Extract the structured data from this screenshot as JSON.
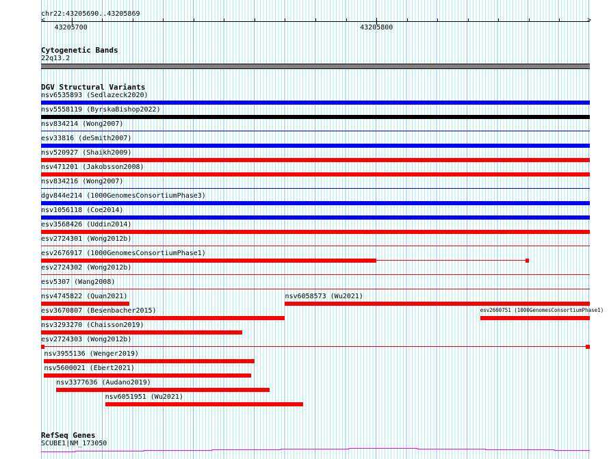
{
  "view": {
    "location": "chr22:43205690..43205869",
    "start": 43205690,
    "end": 43205870
  },
  "ruler": {
    "labels": [
      {
        "bp": 43205700,
        "text": "43205700"
      },
      {
        "bp": 43205800,
        "text": "43205800"
      }
    ]
  },
  "cytobands": {
    "title": "Cytogenetic Bands",
    "band": "22q13.2",
    "color": "#808080"
  },
  "dgv": {
    "title": "DGV Structural Variants",
    "colors": {
      "blue": "#0000ff",
      "red": "#ff0000",
      "black": "#000000"
    },
    "features": [
      {
        "label": "nsv6535893 (Sedlazeck2020)",
        "row": 0,
        "start": 43205690,
        "end": 43205870,
        "color": "blue",
        "style": "thick"
      },
      {
        "label": "nsv5558119 (ByrskaBishop2022)",
        "row": 1,
        "start": 43205690,
        "end": 43205870,
        "color": "black",
        "style": "thick"
      },
      {
        "label": "nsv834214 (Wong2007)",
        "row": 2,
        "start": 43205690,
        "end": 43205870,
        "color": "blue",
        "style": "thin"
      },
      {
        "label": "esv33816 (deSmith2007)",
        "row": 3,
        "start": 43205690,
        "end": 43205870,
        "color": "blue",
        "style": "thick"
      },
      {
        "label": "nsv520927 (Shaikh2009)",
        "row": 4,
        "start": 43205690,
        "end": 43205870,
        "color": "red",
        "style": "thick"
      },
      {
        "label": "nsv471201 (Jakobsson2008)",
        "row": 5,
        "start": 43205690,
        "end": 43205870,
        "color": "red",
        "style": "thick"
      },
      {
        "label": "nsv834216 (Wong2007)",
        "row": 6,
        "start": 43205690,
        "end": 43205870,
        "color": "blue",
        "style": "thin"
      },
      {
        "label": "dgv844e214 (1000GenomesConsortiumPhase3)",
        "row": 7,
        "start": 43205690,
        "end": 43205870,
        "color": "blue",
        "style": "thick"
      },
      {
        "label": "nsv1056118 (Coe2014)",
        "row": 8,
        "start": 43205690,
        "end": 43205870,
        "color": "blue",
        "style": "thick"
      },
      {
        "label": "esv3568426 (Uddin2014)",
        "row": 9,
        "start": 43205690,
        "end": 43205870,
        "color": "red",
        "style": "thick"
      },
      {
        "label": "esv2724301 (Wong2012b)",
        "row": 10,
        "start": 43205690,
        "end": 43205870,
        "color": "red",
        "style": "thin"
      },
      {
        "label": "esv2676917 (1000GenomesConsortiumPhase1)",
        "row": 11,
        "start": 43205690,
        "end": 43205850,
        "color": "red",
        "style": "blocks",
        "blocks": [
          [
            43205690,
            43205800
          ],
          [
            43205849,
            43205850
          ]
        ]
      },
      {
        "label": "esv2724302 (Wong2012b)",
        "row": 12,
        "start": 43205690,
        "end": 43205870,
        "color": "red",
        "style": "thin"
      },
      {
        "label": "esv5307 (Wang2008)",
        "row": 13,
        "start": 43205690,
        "end": 43205870,
        "color": "red",
        "style": "thin"
      },
      {
        "label": "nsv4745822 (Quan2021)",
        "row": 14,
        "start": 43205690,
        "end": 43205719,
        "color": "red",
        "style": "thick"
      },
      {
        "label": "nsv6058573 (Wu2021)",
        "row": 14,
        "start": 43205770,
        "end": 43205870,
        "color": "red",
        "style": "thick"
      },
      {
        "label": "esv3670807 (Besenbacher2015)",
        "row": 15,
        "start": 43205690,
        "end": 43205770,
        "color": "red",
        "style": "thick"
      },
      {
        "label": "esv2660751 (1000GenomesConsortiumPhase1)",
        "row": 15,
        "start": 43205834,
        "end": 43205870,
        "color": "red",
        "style": "thick"
      },
      {
        "label": "nsv3293270 (Chaisson2019)",
        "row": 16,
        "start": 43205690,
        "end": 43205756,
        "color": "red",
        "style": "thick"
      },
      {
        "label": "esv2724303 (Wong2012b)",
        "row": 17,
        "start": 43205690,
        "end": 43205870,
        "color": "red",
        "style": "blocks",
        "blocks": [
          [
            43205690,
            43205691
          ],
          [
            43205868.6,
            43205870
          ]
        ]
      },
      {
        "label": "nsv3955136 (Wenger2019)",
        "row": 18,
        "start": 43205691,
        "end": 43205760,
        "color": "red",
        "style": "thick"
      },
      {
        "label": "nsv5600021 (Ebert2021)",
        "row": 19,
        "start": 43205691,
        "end": 43205759,
        "color": "red",
        "style": "thick"
      },
      {
        "label": "nsv3377636 (Audano2019)",
        "row": 20,
        "start": 43205695,
        "end": 43205765,
        "color": "red",
        "style": "thick"
      },
      {
        "label": "nsv6051951 (Wu2021)",
        "row": 21,
        "start": 43205711,
        "end": 43205776,
        "color": "red",
        "style": "thick"
      }
    ]
  },
  "refseq": {
    "title": "RefSeq Genes",
    "gene": "SCUBE1|NM_173050",
    "color": "#ff00ff"
  }
}
